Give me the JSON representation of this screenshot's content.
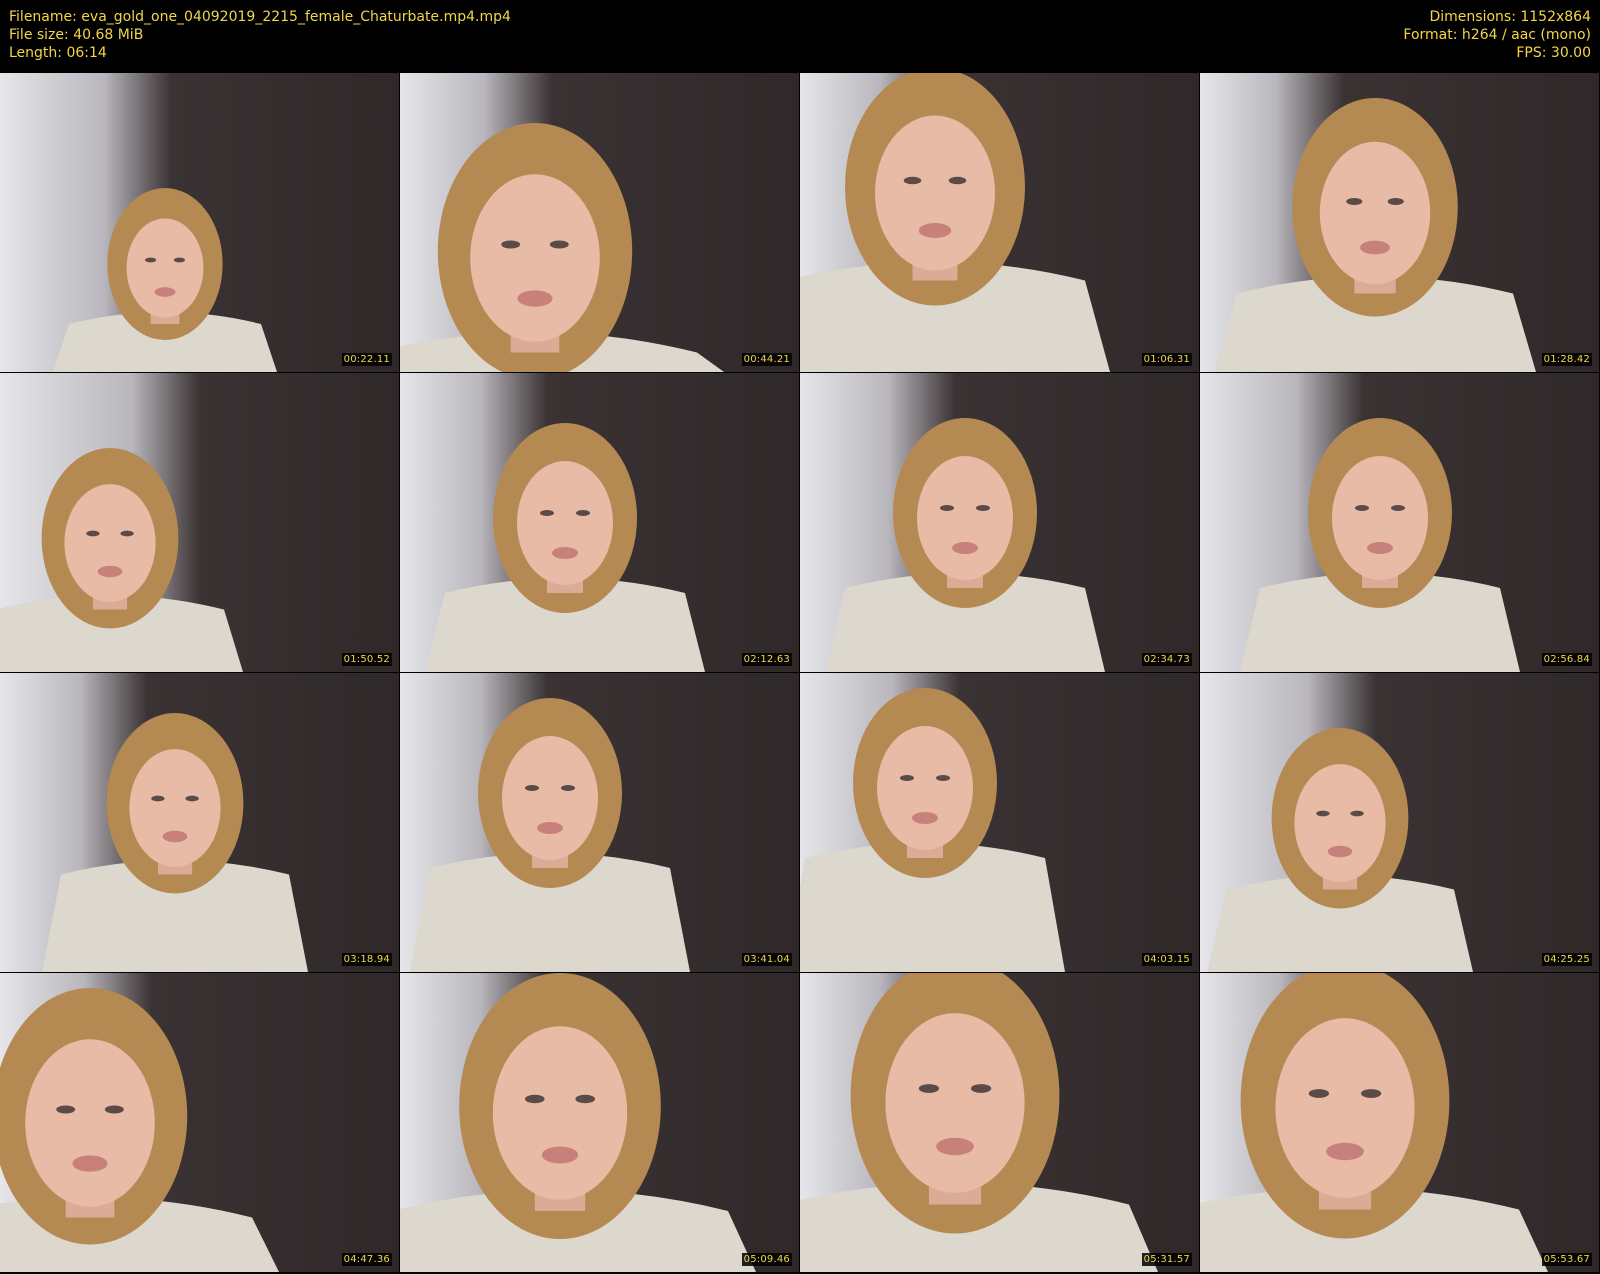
{
  "header": {
    "filename": "Filename: eva_gold_one_04092019_2215_female_Chaturbate.mp4.mp4",
    "filesize": "File size: 40.68 MiB",
    "length": "Length: 06:14",
    "dimensions": "Dimensions: 1152x864",
    "format": "Format: h264 / aac (mono)",
    "fps": "FPS: 30.00"
  },
  "colors": {
    "meta_text": "#f1d64a",
    "background": "#000000",
    "wall_dark": "#3a3233",
    "wall_light": "#e6e6ea",
    "shirt": "#ddd8ce",
    "skin": "#e8bba6",
    "hair": "#b58a52"
  },
  "thumbnails": [
    {
      "timestamp": "00:22.11"
    },
    {
      "timestamp": "00:44.21"
    },
    {
      "timestamp": "01:06.31"
    },
    {
      "timestamp": "01:28.42"
    },
    {
      "timestamp": "01:50.52"
    },
    {
      "timestamp": "02:12.63"
    },
    {
      "timestamp": "02:34.73"
    },
    {
      "timestamp": "02:56.84"
    },
    {
      "timestamp": "03:18.94"
    },
    {
      "timestamp": "03:41.04"
    },
    {
      "timestamp": "04:03.15"
    },
    {
      "timestamp": "04:25.25"
    },
    {
      "timestamp": "04:47.36"
    },
    {
      "timestamp": "05:09.46"
    },
    {
      "timestamp": "05:31.57"
    },
    {
      "timestamp": "05:53.67"
    }
  ]
}
